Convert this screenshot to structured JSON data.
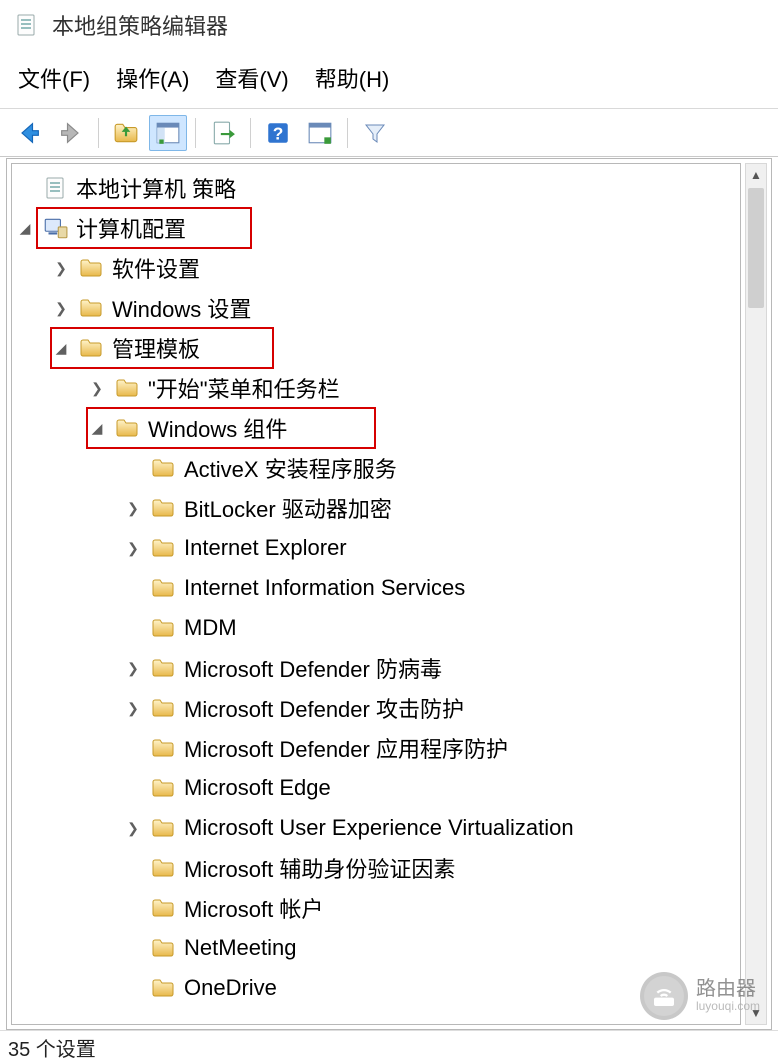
{
  "title": "本地组策略编辑器",
  "menu": {
    "file": "文件(F)",
    "action": "操作(A)",
    "view": "查看(V)",
    "help": "帮助(H)"
  },
  "toolbar": {
    "selected": "show-hide-tree"
  },
  "tree": {
    "root": {
      "label": "本地计算机 策略"
    },
    "computer_config": {
      "label": "计算机配置"
    },
    "software_settings": {
      "label": "软件设置"
    },
    "windows_settings": {
      "label": "Windows 设置"
    },
    "admin_templates": {
      "label": "管理模板"
    },
    "start_taskbar": {
      "label": "\"开始\"菜单和任务栏"
    },
    "windows_components": {
      "label": "Windows 组件"
    },
    "children": [
      {
        "label": "ActiveX 安装程序服务",
        "exp": "none"
      },
      {
        "label": "BitLocker 驱动器加密",
        "exp": "closed"
      },
      {
        "label": "Internet Explorer",
        "exp": "closed"
      },
      {
        "label": "Internet Information Services",
        "exp": "none"
      },
      {
        "label": "MDM",
        "exp": "none"
      },
      {
        "label": "Microsoft Defender 防病毒",
        "exp": "closed"
      },
      {
        "label": "Microsoft Defender 攻击防护",
        "exp": "closed"
      },
      {
        "label": "Microsoft Defender 应用程序防护",
        "exp": "none"
      },
      {
        "label": "Microsoft Edge",
        "exp": "none"
      },
      {
        "label": "Microsoft User Experience Virtualization",
        "exp": "closed"
      },
      {
        "label": "Microsoft 辅助身份验证因素",
        "exp": "none"
      },
      {
        "label": "Microsoft 帐户",
        "exp": "none"
      },
      {
        "label": "NetMeeting",
        "exp": "none"
      },
      {
        "label": "OneDrive",
        "exp": "none"
      }
    ]
  },
  "status": "35 个设置",
  "watermark": {
    "name": "路由器",
    "sub": "luyouqi.com"
  },
  "colors": {
    "highlight": "#d60000",
    "folder1": "#ffe9a8",
    "folder2": "#e8b84a"
  }
}
